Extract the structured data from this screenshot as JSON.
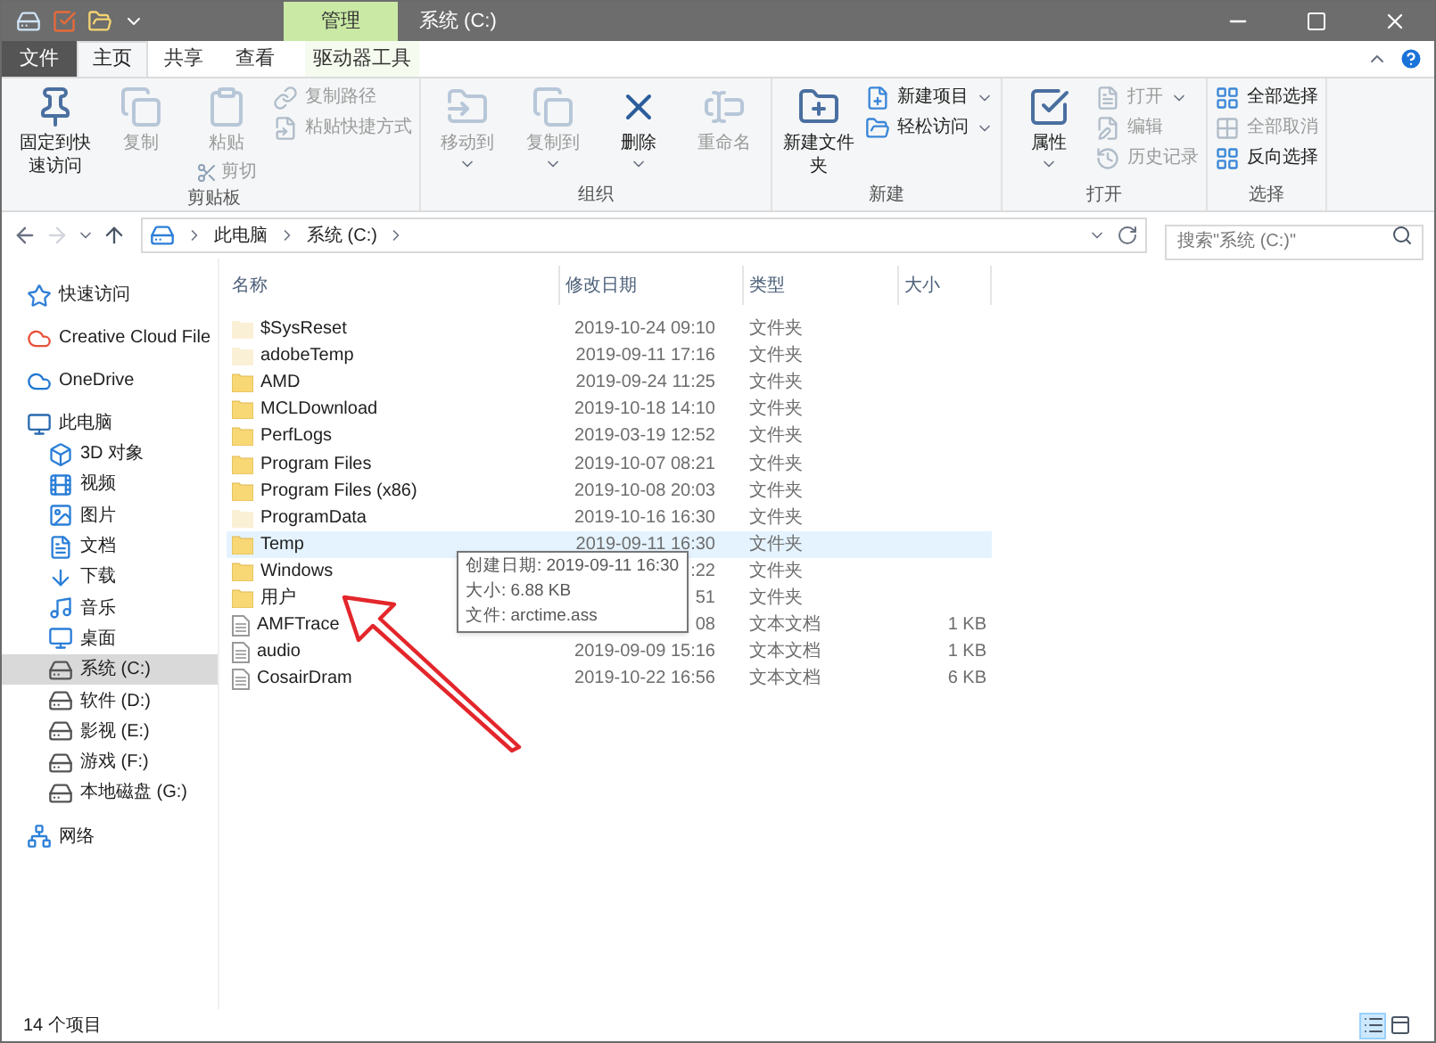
{
  "title_bar": {
    "context_tab": "管理",
    "title": "系统 (C:)"
  },
  "tabs": [
    {
      "label": "文件",
      "kind": "file",
      "selected": false
    },
    {
      "label": "主页",
      "kind": "tab",
      "selected": true
    },
    {
      "label": "共享",
      "kind": "tab",
      "selected": false
    },
    {
      "label": "查看",
      "kind": "tab",
      "selected": false
    },
    {
      "label": "驱动器工具",
      "kind": "context",
      "selected": false
    }
  ],
  "ribbon": {
    "groups": [
      {
        "label": "剪贴板",
        "items": [
          {
            "kind": "large",
            "label": "固定到快速访问",
            "disabled": false
          },
          {
            "kind": "large",
            "label": "复制",
            "disabled": true
          },
          {
            "kind": "large",
            "label": "粘贴",
            "disabled": true,
            "sub": {
              "label": "剪切",
              "disabled": true
            }
          },
          {
            "kind": "small",
            "label": "复制路径",
            "disabled": true
          },
          {
            "kind": "small",
            "label": "粘贴快捷方式",
            "disabled": true
          }
        ]
      },
      {
        "label": "组织",
        "items": [
          {
            "kind": "large",
            "label": "移动到",
            "disabled": true,
            "dropdown": true
          },
          {
            "kind": "large",
            "label": "复制到",
            "disabled": true,
            "dropdown": true
          },
          {
            "kind": "large",
            "label": "删除",
            "disabled": false,
            "dropdown": true
          },
          {
            "kind": "large",
            "label": "重命名",
            "disabled": true
          }
        ]
      },
      {
        "label": "新建",
        "items": [
          {
            "kind": "large",
            "label": "新建文件夹",
            "disabled": false
          },
          {
            "kind": "small",
            "label": "新建项目",
            "disabled": false,
            "dropdown": true
          },
          {
            "kind": "small",
            "label": "轻松访问",
            "disabled": false,
            "dropdown": true
          }
        ]
      },
      {
        "label": "打开",
        "items": [
          {
            "kind": "large",
            "label": "属性",
            "disabled": false,
            "dropdown": true
          },
          {
            "kind": "small",
            "label": "打开",
            "disabled": true,
            "dropdown": true
          },
          {
            "kind": "small",
            "label": "编辑",
            "disabled": true
          },
          {
            "kind": "small",
            "label": "历史记录",
            "disabled": true
          }
        ]
      },
      {
        "label": "选择",
        "items": [
          {
            "kind": "small",
            "label": "全部选择",
            "disabled": false
          },
          {
            "kind": "small",
            "label": "全部取消",
            "disabled": true
          },
          {
            "kind": "small",
            "label": "反向选择",
            "disabled": false
          }
        ]
      }
    ]
  },
  "address": {
    "crumbs": [
      "此电脑",
      "系统 (C:)"
    ],
    "search_placeholder": "搜索\"系统 (C:)\""
  },
  "sidebar": {
    "items": [
      {
        "label": "快速访问",
        "selected": false
      },
      {
        "label": "Creative Cloud File",
        "selected": false
      },
      {
        "label": "OneDrive",
        "selected": false
      },
      {
        "label": "此电脑",
        "selected": false,
        "children": [
          {
            "label": "3D 对象",
            "selected": false
          },
          {
            "label": "视频",
            "selected": false
          },
          {
            "label": "图片",
            "selected": false
          },
          {
            "label": "文档",
            "selected": false
          },
          {
            "label": "下载",
            "selected": false
          },
          {
            "label": "音乐",
            "selected": false
          },
          {
            "label": "桌面",
            "selected": false
          },
          {
            "label": "系统 (C:)",
            "selected": true
          },
          {
            "label": "软件 (D:)",
            "selected": false
          },
          {
            "label": "影视 (E:)",
            "selected": false
          },
          {
            "label": "游戏 (F:)",
            "selected": false
          },
          {
            "label": "本地磁盘 (G:)",
            "selected": false
          }
        ]
      },
      {
        "label": "网络",
        "selected": false
      }
    ]
  },
  "table": {
    "columns": [
      "名称",
      "修改日期",
      "类型",
      "大小"
    ],
    "rows": [
      {
        "name": "$SysReset",
        "date": "2019-10-24 09:10",
        "type": "文件夹",
        "kind": "folder",
        "hidden": true,
        "selected": false
      },
      {
        "name": "adobeTemp",
        "date": "2019-09-11 17:16",
        "type": "文件夹",
        "kind": "folder",
        "hidden": true,
        "selected": false
      },
      {
        "name": "AMD",
        "date": "2019-09-24 11:25",
        "type": "文件夹",
        "kind": "folder",
        "hidden": false,
        "selected": false
      },
      {
        "name": "MCLDownload",
        "date": "2019-10-18 14:10",
        "type": "文件夹",
        "kind": "folder",
        "hidden": false,
        "selected": false
      },
      {
        "name": "PerfLogs",
        "date": "2019-03-19 12:52",
        "type": "文件夹",
        "kind": "folder",
        "hidden": false,
        "selected": false
      },
      {
        "name": "Program Files",
        "date": "2019-10-07 08:21",
        "type": "文件夹",
        "kind": "folder",
        "hidden": false,
        "selected": false
      },
      {
        "name": "Program Files (x86)",
        "date": "2019-10-08 20:03",
        "type": "文件夹",
        "kind": "folder",
        "hidden": false,
        "selected": false
      },
      {
        "name": "ProgramData",
        "date": "2019-10-16 16:30",
        "type": "文件夹",
        "kind": "folder",
        "hidden": true,
        "selected": false
      },
      {
        "name": "Temp",
        "date": "2019-09-11 16:30",
        "type": "文件夹",
        "kind": "folder",
        "hidden": false,
        "selected": true
      },
      {
        "name": "Windows",
        "date": ":22",
        "type": "文件夹",
        "kind": "folder",
        "hidden": false,
        "selected": false
      },
      {
        "name": "用户",
        "date": "51",
        "type": "文件夹",
        "kind": "folder",
        "hidden": false,
        "selected": false
      },
      {
        "name": "AMFTrace",
        "date": "08",
        "type": "文本文档",
        "size": "1 KB",
        "kind": "text",
        "selected": false
      },
      {
        "name": "audio",
        "date": "2019-09-09 15:16",
        "type": "文本文档",
        "size": "1 KB",
        "kind": "text",
        "selected": false
      },
      {
        "name": "CosairDram",
        "date": "2019-10-22 16:56",
        "type": "文本文档",
        "size": "6 KB",
        "kind": "text",
        "selected": false
      }
    ]
  },
  "tooltip": {
    "lines": [
      "创建日期: 2019-09-11 16:30",
      "大小: 6.88 KB",
      "文件: arctime.ass"
    ]
  },
  "status_bar": {
    "count": "14 个项目",
    "views": [
      {
        "selected": true
      },
      {
        "selected": false
      }
    ]
  }
}
